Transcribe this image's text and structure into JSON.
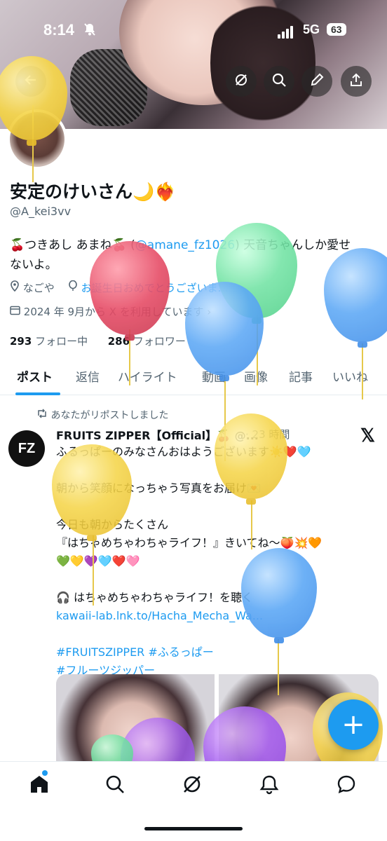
{
  "status_bar": {
    "time": "8:14",
    "network": "5G",
    "battery": "63"
  },
  "profile": {
    "display_name": "安定のけいさん🌙❤️‍🔥",
    "handle": "@A_kei3vv",
    "bio_prefix": "🍒つきあし あまね🍒 (",
    "bio_mention": "@amane_fz1026",
    "bio_suffix": ") 天音ちゃんしか愛せ",
    "bio_line2": "ないよ。",
    "location": "なごや",
    "website": "お誕生日おめでとうございま…",
    "joined": "2024 年 9月から X を利用しています",
    "following_count": "293",
    "following_label": "フォロー中",
    "followers_count": "286",
    "followers_label": "フォロワー"
  },
  "tabs": [
    "ポスト",
    "返信",
    "ハイライト",
    "動画",
    "画像",
    "記事",
    "いいね"
  ],
  "post": {
    "repost_label": "あなたがリポストしました",
    "avatar_text": "FZ",
    "author": "FRUITS ZIPPER【Official】🍒 @...",
    "time": "· 23 時間",
    "lines": [
      "ふるっぱーのみなさんおはようございます☀️❤️🩵",
      "",
      "朝から笑顔になっちゃう写真をお届け💌",
      "",
      "今日も朝からたくさん",
      "『はちゃめちゃわちゃライフ！』きいてね〜🍑💥🧡",
      "💚💛💜🩵❤️🩷",
      "",
      "🎧 はちゃめちゃわちゃライフ！を聴く"
    ],
    "link": "kawaii-lab.lnk.to/Hacha_Mecha_Wa...",
    "hashtags1": "#FRUITSZIPPER #ふるっぱー",
    "hashtags2": "#フルーツジッパー"
  },
  "fab_label": "+",
  "colors": {
    "accent": "#1d9bf0",
    "text_primary": "#0f1419",
    "text_secondary": "#536471"
  },
  "icons": [
    "bell-slash-icon",
    "back-arrow-icon",
    "grok-icon",
    "search-icon",
    "edit-icon",
    "share-icon",
    "location-icon",
    "balloon-icon",
    "calendar-icon",
    "repost-icon",
    "x-logo-icon",
    "home-icon",
    "explore-icon",
    "notifications-icon",
    "messages-icon"
  ]
}
